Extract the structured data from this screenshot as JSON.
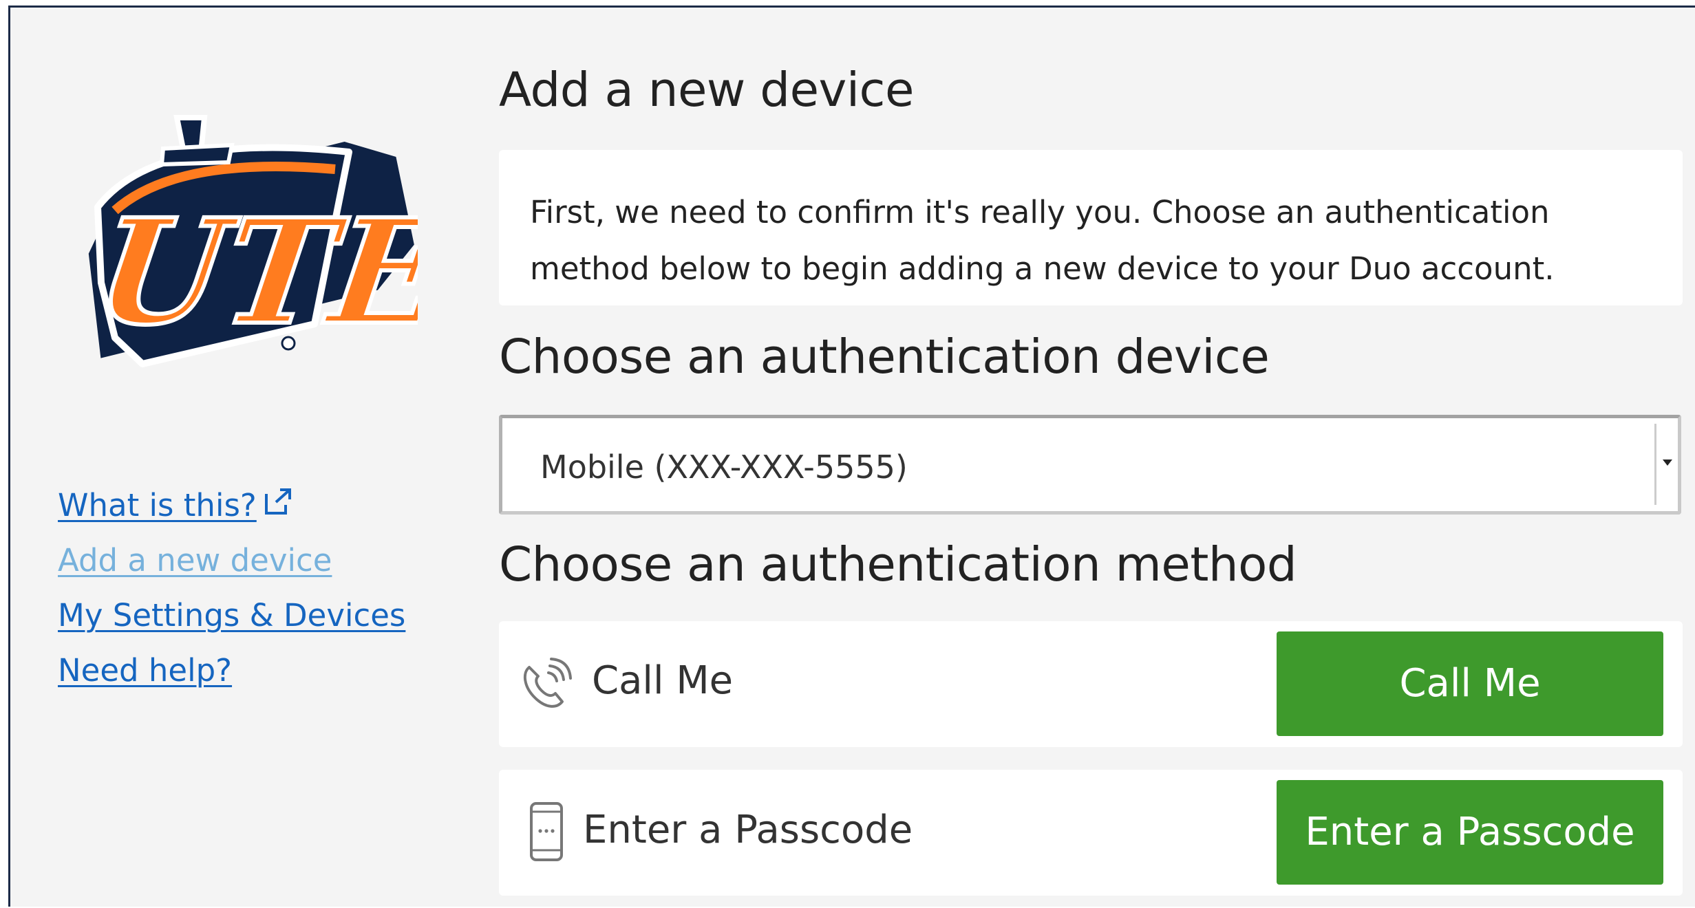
{
  "logo": {
    "text": "UTEP",
    "alt": "UTEP"
  },
  "sidebar": {
    "links": [
      {
        "label": "What is this?",
        "icon": "external-link-icon"
      },
      {
        "label": "Add a new device",
        "state": "current"
      },
      {
        "label": "My Settings & Devices"
      },
      {
        "label": "Need help?"
      }
    ]
  },
  "main": {
    "title": "Add a new device",
    "info_lines": [
      "First, we need to confirm it's really you. Choose an authentication",
      "method below to begin adding a new device to your Duo account."
    ],
    "device_heading": "Choose an authentication device",
    "device_select": {
      "selected": "Mobile (XXX-XXX-5555)"
    },
    "method_heading": "Choose an authentication method",
    "methods": [
      {
        "icon": "phone-call-icon",
        "label": "Call Me",
        "button": "Call Me"
      },
      {
        "icon": "mobile-passcode-icon",
        "label": "Enter a Passcode",
        "button": "Enter a Passcode"
      }
    ]
  },
  "colors": {
    "frame_border": "#1c2b47",
    "page_background": "#f4f4f4",
    "link": "#1565c0",
    "link_current": "#76b1dc",
    "button": "#3e9a2c",
    "logo_navy": "#0e2245",
    "logo_orange": "#ff7c1f"
  }
}
